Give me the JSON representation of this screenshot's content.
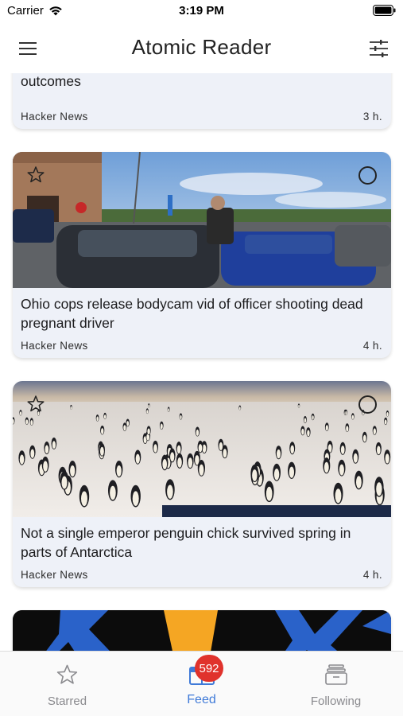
{
  "status_bar": {
    "carrier": "Carrier",
    "time": "3:19 PM"
  },
  "nav": {
    "title": "Atomic Reader",
    "menu_icon": "hamburger-menu-icon",
    "filter_icon": "sliders-filter-icon"
  },
  "articles": [
    {
      "title": "Patients treated by female surgeons have better outcomes",
      "title_visible_line": "outcomes",
      "source": "Hacker News",
      "age": "3 h.",
      "partial": true
    },
    {
      "title": "Ohio cops release bodycam vid of officer shooting dead pregnant driver",
      "source": "Hacker News",
      "age": "4 h.",
      "image": "parking-lot-police-scene"
    },
    {
      "title": "Not a single emperor penguin chick survived spring in parts of Antarctica",
      "source": "Hacker News",
      "age": "4 h.",
      "image": "emperor-penguins-on-ice"
    },
    {
      "image": "blue-yellow-graphic",
      "partial": true
    }
  ],
  "tab_bar": {
    "tabs": [
      {
        "label": "Starred",
        "icon": "star-icon",
        "active": false
      },
      {
        "label": "Feed",
        "icon": "feed-icon",
        "active": true,
        "badge": "592"
      },
      {
        "label": "Following",
        "icon": "archive-box-icon",
        "active": false
      }
    ]
  },
  "colors": {
    "accent": "#3f7ad8",
    "badge": "#e0322c",
    "card_bg": "#eef1f8"
  }
}
